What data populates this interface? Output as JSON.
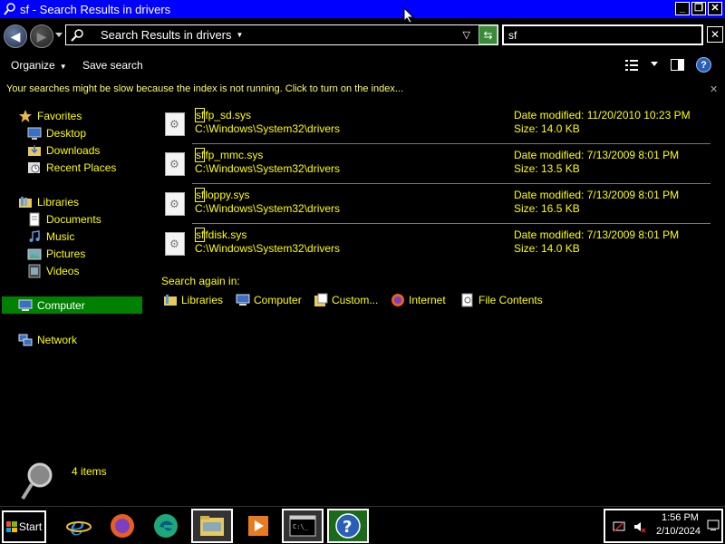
{
  "window": {
    "title": "sf - Search Results in drivers",
    "buttons": {
      "minimize": "_",
      "maximize": "❐",
      "close": "✕"
    }
  },
  "address": {
    "location": "Search Results in drivers",
    "search_value": "sf"
  },
  "toolbar": {
    "organize_label": "Organize",
    "save_search_label": "Save search",
    "help_label": "?"
  },
  "infobar": {
    "message": "Your searches might be slow because the index is not running.  Click to turn on the index...",
    "close": "✕"
  },
  "nav": {
    "favorites": "Favorites",
    "desktop": "Desktop",
    "downloads": "Downloads",
    "recent_places": "Recent Places",
    "libraries": "Libraries",
    "documents": "Documents",
    "music": "Music",
    "pictures": "Pictures",
    "videos": "Videos",
    "computer": "Computer",
    "network": "Network"
  },
  "results": [
    {
      "name_hl": "sf",
      "name_rest": "fp_sd.sys",
      "path": "C:\\Windows\\System32\\drivers",
      "date": "Date modified: 11/20/2010 10:23 PM",
      "size": "Size: 14.0 KB"
    },
    {
      "name_hl": "sf",
      "name_rest": "fp_mmc.sys",
      "path": "C:\\Windows\\System32\\drivers",
      "date": "Date modified: 7/13/2009 8:01 PM",
      "size": "Size: 13.5 KB"
    },
    {
      "name_hl": "sf",
      "name_rest": "loppy.sys",
      "path": "C:\\Windows\\System32\\drivers",
      "date": "Date modified: 7/13/2009 8:01 PM",
      "size": "Size: 16.5 KB"
    },
    {
      "name_hl": "sf",
      "name_rest": "fdisk.sys",
      "path": "C:\\Windows\\System32\\drivers",
      "date": "Date modified: 7/13/2009 8:01 PM",
      "size": "Size: 14.0 KB"
    }
  ],
  "search_again": {
    "label": "Search again in:",
    "items": [
      "Libraries",
      "Computer",
      "Custom...",
      "Internet",
      "File Contents"
    ]
  },
  "details": {
    "count": "4 items"
  },
  "taskbar": {
    "start_label": "Start",
    "time": "1:56 PM",
    "date": "2/10/2024"
  }
}
